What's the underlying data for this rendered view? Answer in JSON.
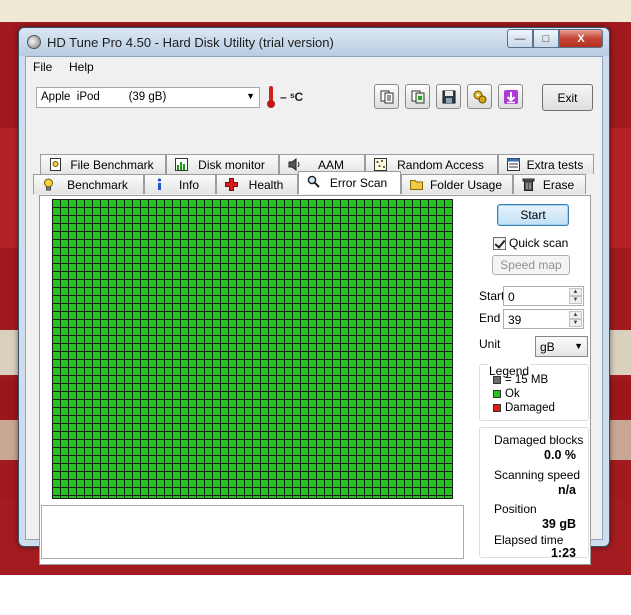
{
  "window": {
    "title": "HD Tune Pro 4.50 - Hard Disk Utility (trial version)",
    "caption_buttons": {
      "minimize": "—",
      "maximize": "□",
      "close": "X"
    }
  },
  "menu": [
    {
      "label": "File"
    },
    {
      "label": "Help"
    }
  ],
  "toolbar": {
    "drive": "Apple  iPod         (39 gB)",
    "temperature": "– ˢC",
    "exit_label": "Exit",
    "buttons": [
      {
        "icon": "copy-text-icon"
      },
      {
        "icon": "copy-screen-icon"
      },
      {
        "icon": "save-icon"
      },
      {
        "icon": "options-icon"
      },
      {
        "icon": "download-arrow-icon"
      }
    ]
  },
  "tabs": {
    "top_row": [
      {
        "label": "File Benchmark",
        "icon": "file-benchmark-icon"
      },
      {
        "label": "Disk monitor",
        "icon": "disk-monitor-icon"
      },
      {
        "label": "AAM",
        "icon": "speaker-icon"
      },
      {
        "label": "Random Access",
        "icon": "random-access-icon"
      },
      {
        "label": "Extra tests",
        "icon": "extra-tests-icon"
      }
    ],
    "bottom_row": [
      {
        "label": "Benchmark",
        "icon": "lightbulb-icon"
      },
      {
        "label": "Info",
        "icon": "info-icon"
      },
      {
        "label": "Health",
        "icon": "health-cross-icon"
      },
      {
        "label": "Error Scan",
        "icon": "magnifier-icon",
        "active": true
      },
      {
        "label": "Folder Usage",
        "icon": "folder-icon"
      },
      {
        "label": "Erase",
        "icon": "trash-icon"
      }
    ]
  },
  "error_scan": {
    "start_label": "Start",
    "quick_scan_label": "Quick scan",
    "quick_scan_checked": true,
    "speed_map_label": "Speed map",
    "start_field_label": "Start",
    "start_value": "0",
    "end_field_label": "End",
    "end_value": "39",
    "unit_label": "Unit",
    "unit_value": "gB",
    "legend": {
      "title": "Legend",
      "items": [
        {
          "label": "= 15 MB",
          "color": "#6b6b6b"
        },
        {
          "label": "Ok",
          "color": "#22c51f"
        },
        {
          "label": "Damaged",
          "color": "#e01818"
        }
      ]
    },
    "stats": {
      "damaged_blocks_label": "Damaged blocks",
      "damaged_blocks_value": "0.0 %",
      "scanning_speed_label": "Scanning speed",
      "scanning_speed_value": "n/a",
      "position_label": "Position",
      "position_value": "39 gB",
      "elapsed_label": "Elapsed time",
      "elapsed_value": "1:23"
    },
    "block_color": "#22c51f",
    "grid_color": "#1a1a1a",
    "log_text": ""
  }
}
